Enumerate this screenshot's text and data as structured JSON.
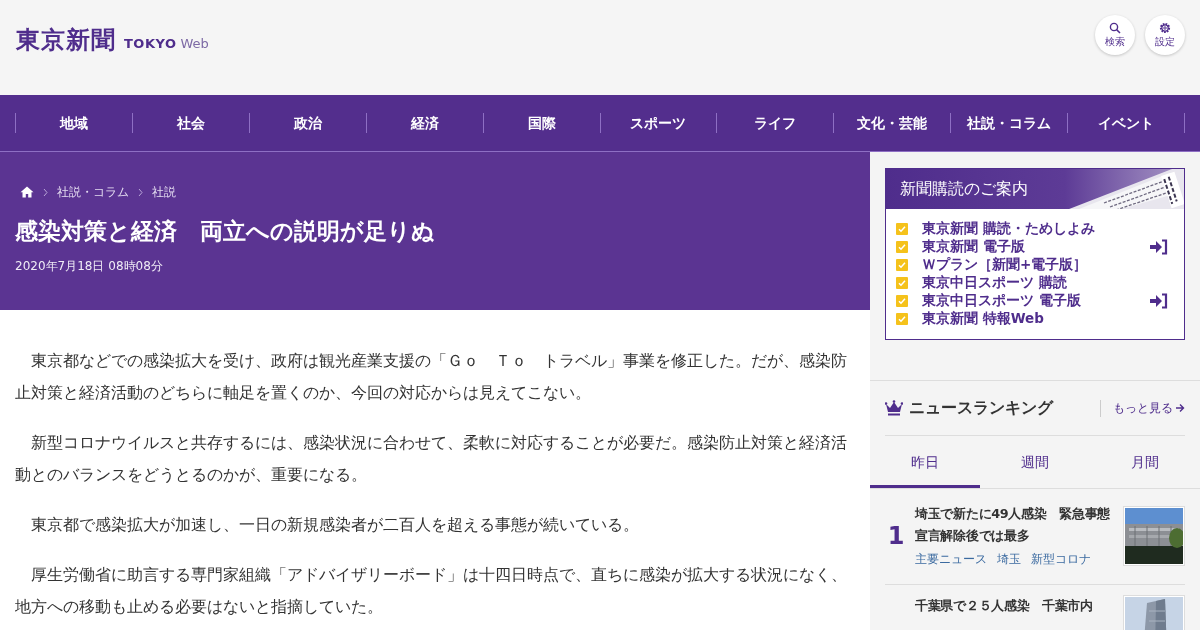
{
  "header": {
    "logo": {
      "name": "東京新聞",
      "tokyo": "TOKYO",
      "web": "Web"
    },
    "buttons": [
      {
        "kind": "search",
        "label": "検索"
      },
      {
        "kind": "settings",
        "label": "設定"
      }
    ]
  },
  "nav": [
    "地域",
    "社会",
    "政治",
    "経済",
    "国際",
    "スポーツ",
    "ライフ",
    "文化・芸能",
    "社説・コラム",
    "イベント"
  ],
  "article": {
    "breadcrumb": [
      "社説・コラム",
      "社説"
    ],
    "title": "感染対策と経済　両立への説明が足りぬ",
    "date": "2020年7月18日 08時08分",
    "paragraphs": [
      "東京都などでの感染拡大を受け、政府は観光産業支援の「Ｇｏ　Ｔｏ　トラベル」事業を修正した。だが、感染防止対策と経済活動のどちらに軸足を置くのか、今回の対応からは見えてこない。",
      "新型コロナウイルスと共存するには、感染状況に合わせて、柔軟に対応することが必要だ。感染防止対策と経済活動とのバランスをどうとるのかが、重要になる。",
      "東京都で感染拡大が加速し、一日の新規感染者が二百人を超える事態が続いている。",
      "厚生労働省に助言する専門家組織「アドバイザリーボード」は十四日時点で、直ちに感染が拡大する状況になく、地方への移動も止める必要はないと指摘していた。"
    ]
  },
  "subscription": {
    "title": "新聞購読のご案内",
    "items": [
      {
        "label": "東京新聞 購読・ためしよみ",
        "login": false
      },
      {
        "label": "東京新聞 電子版",
        "login": true
      },
      {
        "label": "Ｗプラン［新聞+電子版］",
        "login": false
      },
      {
        "label": "東京中日スポーツ 購読",
        "login": false
      },
      {
        "label": "東京中日スポーツ 電子版",
        "login": true
      },
      {
        "label": "東京新聞 特報Web",
        "login": false
      }
    ]
  },
  "ranking": {
    "title": "ニュースランキング",
    "more": "もっと見る",
    "tabs": [
      {
        "label": "昨日",
        "selected": true
      },
      {
        "label": "週間",
        "selected": false
      },
      {
        "label": "月間",
        "selected": false
      }
    ],
    "items": [
      {
        "rank": "1",
        "title": "埼玉で新たに49人感染　緊急事態宣言解除後では最多",
        "tags": [
          "主要ニュース",
          "埼玉",
          "新型コロナ"
        ]
      },
      {
        "title": "千葉県で２５人感染　千葉市内"
      }
    ]
  }
}
